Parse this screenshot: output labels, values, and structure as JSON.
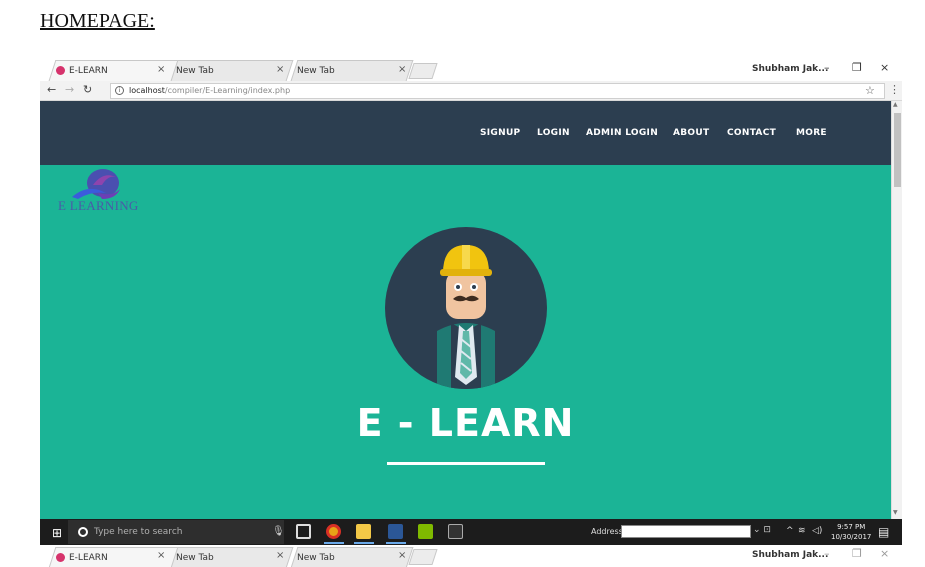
{
  "doc": {
    "heading": "HOMEPAGE:"
  },
  "browser": {
    "tabs": [
      {
        "label": "E-LEARN",
        "active": true
      },
      {
        "label": "New Tab",
        "active": false
      },
      {
        "label": "New Tab",
        "active": false
      }
    ],
    "tab_close_symbol": "×",
    "window_user": "Shubham Jak...",
    "window_controls": {
      "minimize": "–",
      "restore": "❐",
      "close": "×"
    },
    "url_host": "localhost",
    "url_path": "/compiler/E-Learning/index.php",
    "icons": [
      "back-icon",
      "forward-icon",
      "reload-icon",
      "info-icon",
      "star-icon",
      "menu-icon"
    ]
  },
  "site": {
    "nav": [
      "SIGNUP",
      "LOGIN",
      "ADMIN LOGIN",
      "ABOUT",
      "CONTACT",
      "MORE"
    ],
    "logo_text": "E LEARNING",
    "title": "E - LEARN",
    "colors": {
      "navbar": "#2c3e50",
      "hero": "#1bb496",
      "avatar_bg": "#2c3e50",
      "helmet": "#f1c40f"
    }
  },
  "taskbar": {
    "search_placeholder": "Type here to search",
    "address_label": "Address",
    "time": "9:57 PM",
    "date": "10/30/2017",
    "icons": [
      "windows-start-icon",
      "cortana-icon",
      "mic-icon",
      "task-view-icon",
      "chrome-icon",
      "file-explorer-icon",
      "word-icon",
      "notepad-icon",
      "terminal-icon",
      "notification-icon"
    ]
  }
}
